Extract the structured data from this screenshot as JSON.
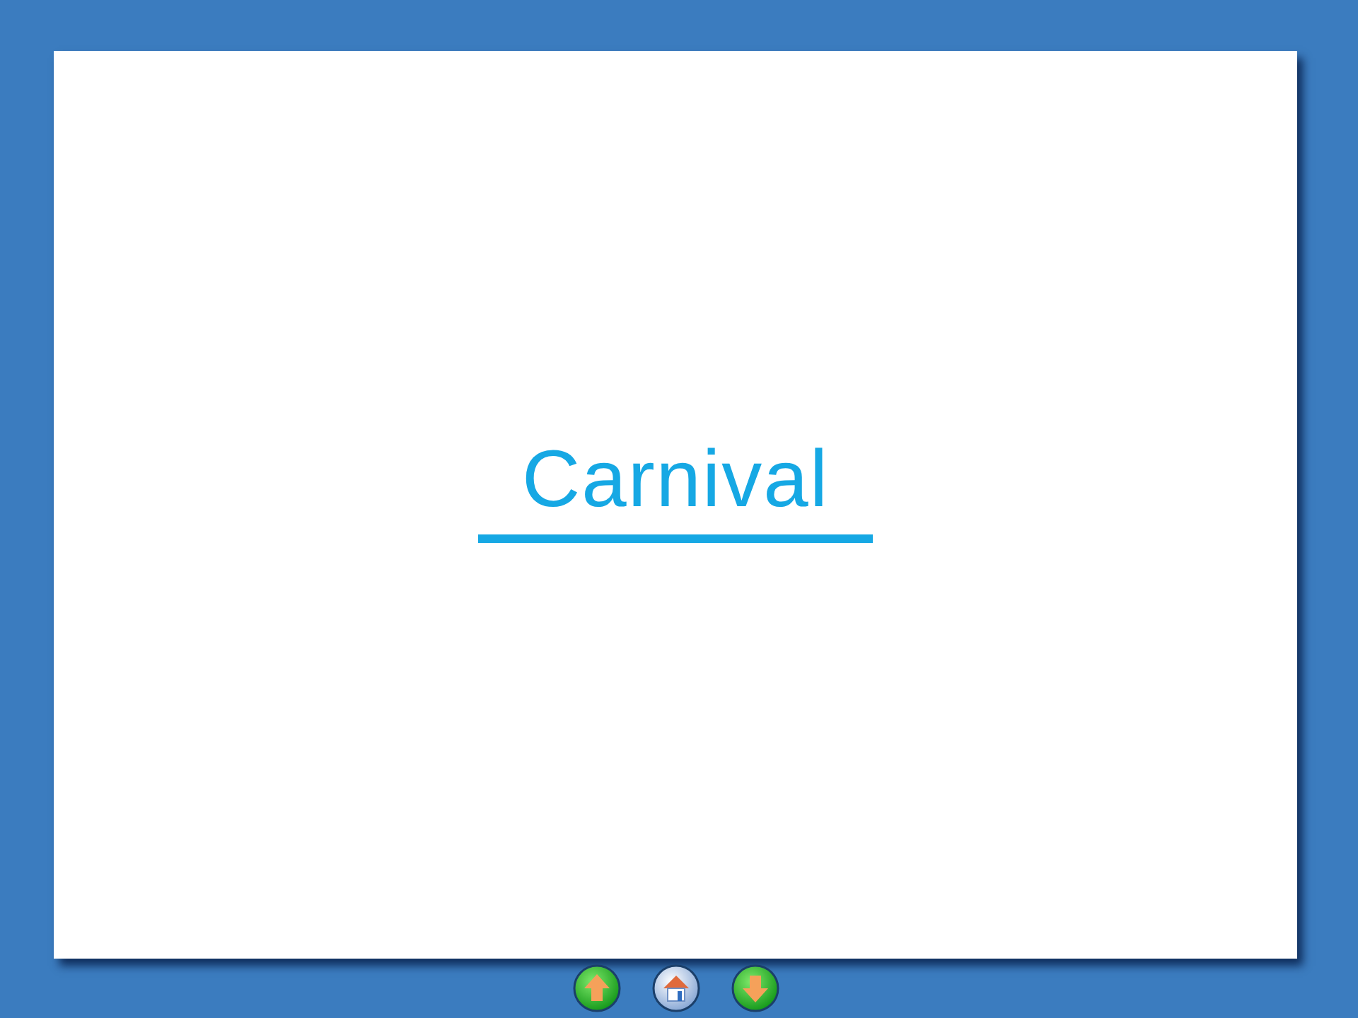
{
  "slide": {
    "title": "Carnival"
  },
  "navigation": [
    {
      "kind": "previous"
    },
    {
      "kind": "home"
    },
    {
      "kind": "next"
    }
  ]
}
